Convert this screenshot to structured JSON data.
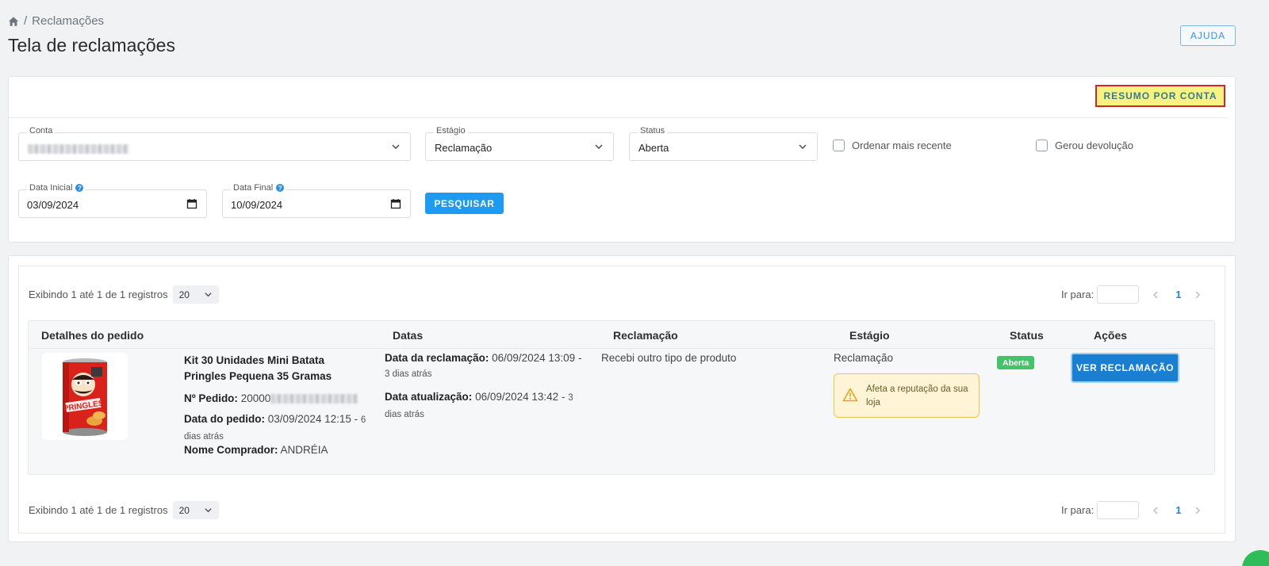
{
  "breadcrumb": {
    "icon": "home-icon",
    "current": "Reclamações",
    "separator": "/"
  },
  "page": {
    "title": "Tela de reclamações"
  },
  "header": {
    "help_label": "AJUDA"
  },
  "filters": {
    "summary_button": "RESUMO POR CONTA",
    "conta": {
      "label": "Conta",
      "value": ""
    },
    "estagio": {
      "label": "Estágio",
      "value": "Reclamação"
    },
    "status": {
      "label": "Status",
      "value": "Aberta"
    },
    "ordenar_recente": {
      "label": "Ordenar mais recente",
      "checked": false
    },
    "gerou_devolucao": {
      "label": "Gerou devolução",
      "checked": false
    },
    "data_inicial": {
      "label": "Data Inicial",
      "value": "03/09/2024"
    },
    "data_final": {
      "label": "Data Final",
      "value": "10/09/2024"
    },
    "search_button": "PESQUISAR"
  },
  "pagination": {
    "summary": "Exibindo 1 até 1 de 1 registros",
    "page_size": "20",
    "goto_label": "Ir para:",
    "current_page": "1"
  },
  "table": {
    "columns": [
      "Detalhes do pedido",
      "Datas",
      "Reclamação",
      "Estágio",
      "Status",
      "Ações"
    ],
    "rows": [
      {
        "product_name": "Kit 30 Unidades Mini Batata Pringles Pequena 35 Gramas",
        "order_label": "Nº Pedido:",
        "order_number_prefix": "20000",
        "order_date_label": "Data do pedido:",
        "order_date": "03/09/2024 12:15 -",
        "order_date_ago": "6 dias atrás",
        "buyer_label": "Nome Comprador:",
        "buyer_name": "ANDRÉIA",
        "claim_date_label": "Data da reclamação:",
        "claim_date": "06/09/2024 13:09 -",
        "claim_date_ago": "3 dias atrás",
        "update_date_label": "Data atualização:",
        "update_date": "06/09/2024 13:42 -",
        "update_date_ago": "3 dias atrás",
        "reason": "Recebi outro tipo de produto",
        "stage": "Reclamação",
        "warning": "Afeta a reputação da sua loja",
        "status": "Aberta",
        "action_label": "VER RECLAMAÇÃO"
      }
    ]
  },
  "colors": {
    "primary": "#1e9af0",
    "status_open": "#45c36a",
    "highlight": "#f6f382",
    "highlight_border": "#d0262e",
    "warning_bg": "#fff5d6"
  }
}
